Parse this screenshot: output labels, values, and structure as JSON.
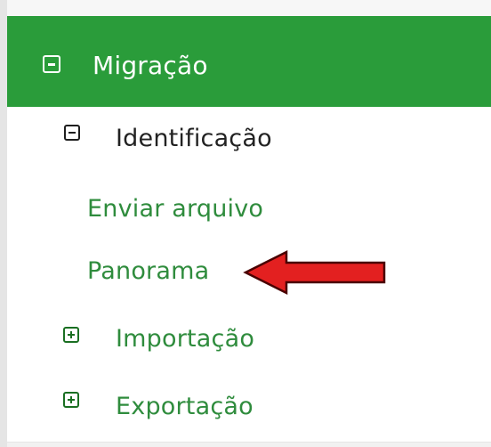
{
  "menu": {
    "header": {
      "label": "Migração",
      "icon": "minus-square-icon",
      "background_color": "#2a9c3a"
    },
    "items": [
      {
        "label": "Identificação",
        "icon": "minus-square-icon"
      },
      {
        "label": "Enviar arquivo"
      },
      {
        "label": "Panorama"
      },
      {
        "label": "Importação",
        "icon": "plus-square-icon"
      },
      {
        "label": "Exportação",
        "icon": "plus-square-icon"
      }
    ],
    "accent_color": "#2f8c3d"
  },
  "annotation": {
    "type": "arrow",
    "target": "Panorama",
    "color": "#e32020"
  }
}
